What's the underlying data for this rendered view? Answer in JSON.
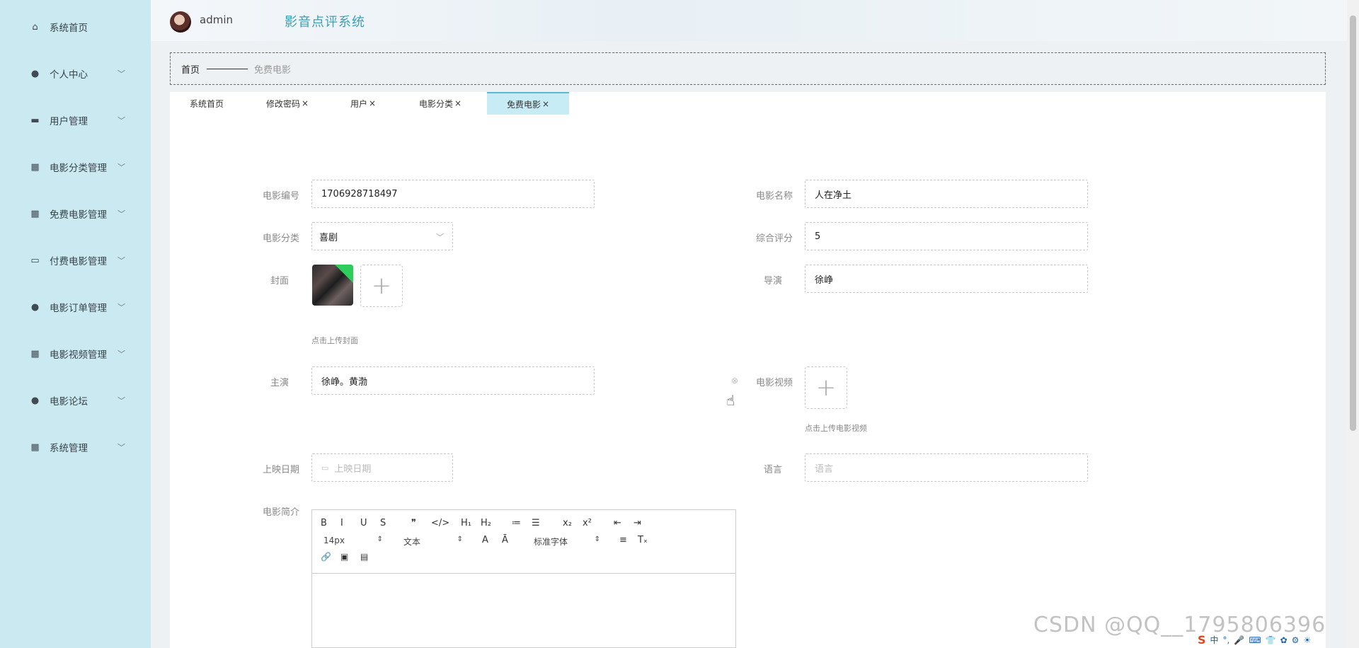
{
  "sidebar": {
    "items": [
      {
        "label": "系统首页",
        "icon": "home-icon",
        "glyph": "⌂",
        "has_children": false
      },
      {
        "label": "个人中心",
        "icon": "user-icon",
        "glyph": "●",
        "has_children": true
      },
      {
        "label": "用户管理",
        "icon": "chat-icon",
        "glyph": "▬",
        "has_children": true
      },
      {
        "label": "电影分类管理",
        "icon": "grid-icon",
        "glyph": "▦",
        "has_children": true
      },
      {
        "label": "免费电影管理",
        "icon": "grid-icon",
        "glyph": "▦",
        "has_children": true
      },
      {
        "label": "付费电影管理",
        "icon": "monitor-icon",
        "glyph": "▭",
        "has_children": true
      },
      {
        "label": "电影订单管理",
        "icon": "user-icon",
        "glyph": "●",
        "has_children": true
      },
      {
        "label": "电影视频管理",
        "icon": "grid-icon",
        "glyph": "▦",
        "has_children": true
      },
      {
        "label": "电影论坛",
        "icon": "bulb-icon",
        "glyph": "●",
        "has_children": true
      },
      {
        "label": "系统管理",
        "icon": "grid-icon",
        "glyph": "▦",
        "has_children": true
      }
    ],
    "chevron": "﹀"
  },
  "header": {
    "username": "admin",
    "system_title": "影音点评系统"
  },
  "breadcrumb": {
    "home": "首页",
    "current": "免费电影"
  },
  "tabs": [
    {
      "label": "系统首页",
      "closable": false,
      "active": false
    },
    {
      "label": "修改密码",
      "closable": true,
      "active": false
    },
    {
      "label": "用户",
      "closable": true,
      "active": false
    },
    {
      "label": "电影分类",
      "closable": true,
      "active": false
    },
    {
      "label": "免费电影",
      "closable": true,
      "active": true
    }
  ],
  "tab_close_glyph": "×",
  "form": {
    "movie_id": {
      "label": "电影编号",
      "value": "1706928718497"
    },
    "movie_name": {
      "label": "电影名称",
      "value": "人在净土"
    },
    "category": {
      "label": "电影分类",
      "value": "喜剧"
    },
    "rating": {
      "label": "综合评分",
      "value": "5"
    },
    "cover": {
      "label": "封面",
      "hint": "点击上传封面"
    },
    "director": {
      "label": "导演",
      "value": "徐峥"
    },
    "actors": {
      "label": "主演",
      "value": "徐峥。黄渤"
    },
    "video": {
      "label": "电影视频",
      "hint": "点击上传电影视频"
    },
    "release_date": {
      "label": "上映日期",
      "placeholder": "上映日期"
    },
    "language": {
      "label": "语言",
      "placeholder": "语言"
    },
    "intro": {
      "label": "电影简介"
    }
  },
  "editor": {
    "row1": [
      "B",
      "I",
      "U",
      "S",
      "❞",
      "</>",
      "H₁",
      "H₂",
      "≔",
      "☰",
      "x₂",
      "x²",
      "⇤",
      "⇥"
    ],
    "font_size": "14px",
    "text_type": "文本",
    "font_family": "标准字体",
    "row2_icons": [
      "A",
      "Ā",
      "≡",
      "Tₓ"
    ],
    "row3": [
      "🔗",
      "▣",
      "▤"
    ]
  },
  "watermark": "CSDN @QQ__1795806396",
  "taskbar": [
    "S",
    "中",
    "°,",
    "🎤",
    "⌨",
    "👕",
    "✿",
    "⚙",
    "☀"
  ]
}
